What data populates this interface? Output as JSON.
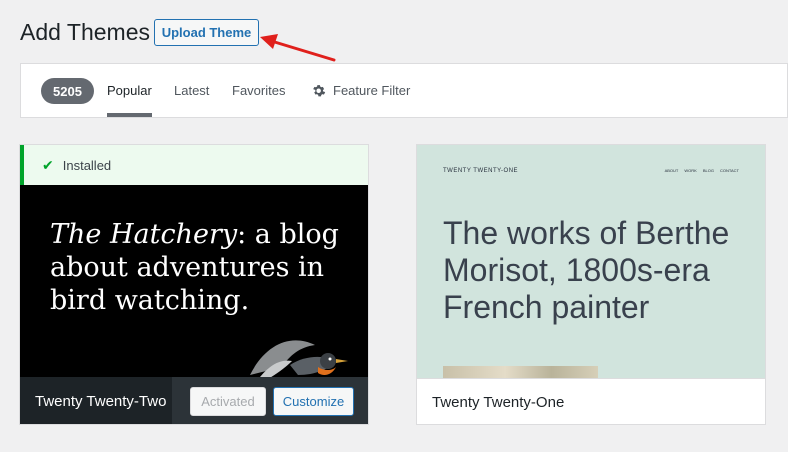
{
  "header": {
    "title": "Add Themes",
    "upload_label": "Upload Theme"
  },
  "filter_bar": {
    "count": "5205",
    "tabs": [
      {
        "label": "Popular",
        "active": true
      },
      {
        "label": "Latest",
        "active": false
      },
      {
        "label": "Favorites",
        "active": false
      }
    ],
    "feature_filter_label": "Feature Filter"
  },
  "themes": [
    {
      "name": "Twenty Twenty-Two",
      "installed_label": "Installed",
      "screenshot_headline_italic": "The Hatchery",
      "screenshot_headline_rest": ": a blog about adventures in bird watching.",
      "activated_label": "Activated",
      "customize_label": "Customize"
    },
    {
      "name": "Twenty Twenty-One",
      "screenshot_site_title": "TWENTY TWENTY-ONE",
      "screenshot_nav": [
        "ABOUT",
        "WORK",
        "BLOG",
        "CONTACT"
      ],
      "screenshot_headline": "The works of Berthe Morisot, 1800s-era French painter"
    }
  ],
  "colors": {
    "accent": "#2271b1",
    "success": "#00a32a",
    "annotation_arrow": "#e0201c",
    "dark_footer": "#1d2327"
  }
}
